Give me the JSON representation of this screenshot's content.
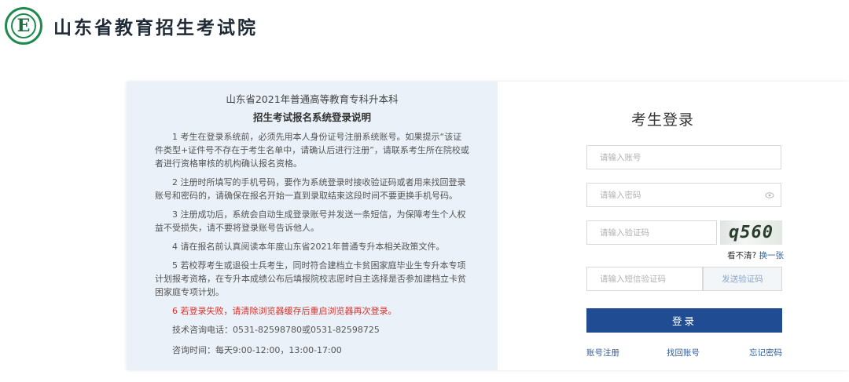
{
  "header": {
    "logo_letter": "E",
    "site_title": "山东省教育招生考试院"
  },
  "notice": {
    "title_line1": "山东省2021年普通高等教育专科升本科",
    "title_line2": "招生考试报名系统登录说明",
    "items": [
      "1 考生在登录系统前，必须先用本人身份证号注册系统账号。如果提示“该证件类型+证件号不存在于考生名单中，请确认后进行注册”，请联系考生所在院校或者进行资格审核的机构确认报名资格。",
      "2 注册时所填写的手机号码，要作为系统登录时接收验证码或者用来找回登录账号和密码的，请确保在报名开始一直到录取结束这段时间不要更换手机号码。",
      "3 注册成功后，系统会自动生成登录账号并发送一条短信，为保障考生个人权益不受损失，请不要将登录账号告诉他人。",
      "4 请在报名前认真阅读本年度山东省2021年普通专升本相关政策文件。",
      "5 若校荐考生或退役士兵考生，同时符合建档立卡贫困家庭毕业生专升本专项计划报考资格，在专升本成绩公布后填报院校志愿时自主选择是否参加建档立卡贫困家庭专项计划。"
    ],
    "warning": "6 若登录失败，请清除浏览器缓存后重启浏览器再次登录。",
    "phone": "技术咨询电话：0531-82598780或0531-82598725",
    "hours": "咨询时间：每天9:00-12:00，13:00-17:00"
  },
  "login": {
    "title": "考生登录",
    "account_placeholder": "请输入账号",
    "password_placeholder": "请输入密码",
    "captcha_placeholder": "请输入验证码",
    "captcha_text": "q560",
    "cant_see": "看不清?",
    "refresh_label": "换一张",
    "sms_placeholder": "请输入短信验证码",
    "send_code_label": "发送验证码",
    "submit_label": "登录",
    "register_link": "账号注册",
    "recover_link": "找回账号",
    "forgot_link": "忘记密码"
  },
  "colors": {
    "brand_green": "#1e8a4e",
    "primary_blue": "#1f4c93",
    "notice_bg": "#eaf1f8",
    "warning_red": "#d9322b",
    "link_blue": "#2d5d9c"
  }
}
